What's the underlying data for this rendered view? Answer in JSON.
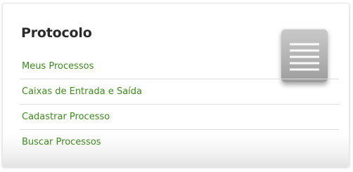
{
  "widget": {
    "title": "Protocolo",
    "icon": "list-document-icon",
    "menu_items": [
      {
        "label": "Meus Processos"
      },
      {
        "label": "Caixas de Entrada e Saída"
      },
      {
        "label": "Cadastrar Processo"
      },
      {
        "label": "Buscar Processos"
      }
    ]
  },
  "colors": {
    "link": "#3e8a1e",
    "title": "#2b2b2b",
    "divider": "#dcdcdc",
    "icon_bg": "#b3b3b3"
  }
}
